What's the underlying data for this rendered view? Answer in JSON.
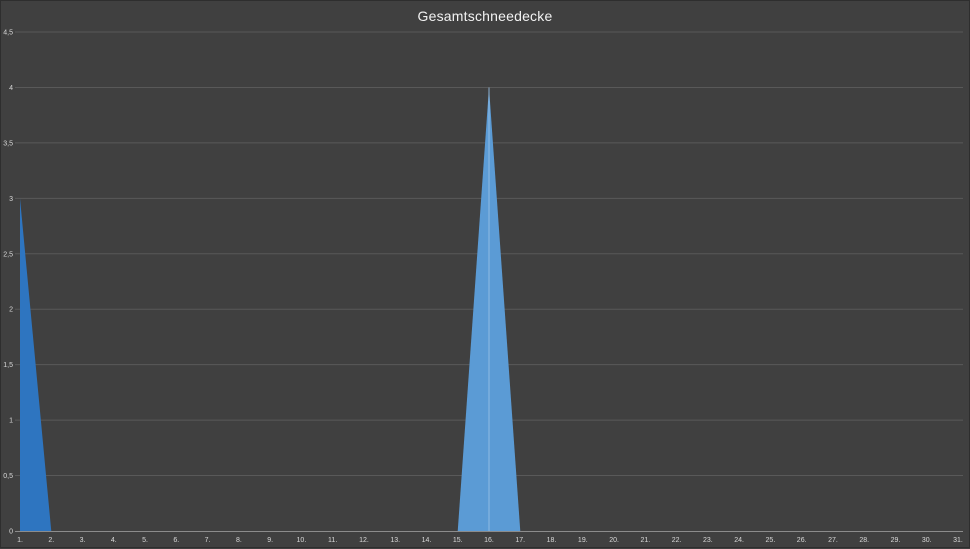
{
  "chart_data": {
    "type": "area",
    "title": "Gesamtschneedecke",
    "categories": [
      "1.",
      "2.",
      "3.",
      "4.",
      "5.",
      "6.",
      "7.",
      "8.",
      "9.",
      "10.",
      "11.",
      "12.",
      "13.",
      "14.",
      "15.",
      "16.",
      "17.",
      "18.",
      "19.",
      "20.",
      "21.",
      "22.",
      "23.",
      "24.",
      "25.",
      "26.",
      "27.",
      "28.",
      "29.",
      "30.",
      "31."
    ],
    "series": [
      {
        "values": [
          3,
          0,
          0,
          0,
          0,
          0,
          0,
          0,
          0,
          0,
          0,
          0,
          0,
          0,
          0,
          4,
          0,
          0,
          0,
          0,
          0,
          0,
          0,
          0,
          0,
          0,
          0,
          0,
          0,
          0,
          0
        ]
      }
    ],
    "y_ticks": [
      "0",
      "0,5",
      "1",
      "1,5",
      "2",
      "2,5",
      "3",
      "3,5",
      "4",
      "4,5"
    ],
    "ylim": [
      0,
      4.5
    ],
    "grid": true,
    "colors": {
      "fill_dark": "#2e75c0",
      "fill_light": "#5b9bd5",
      "divider": "#9dc3e6",
      "background": "#404040"
    }
  }
}
